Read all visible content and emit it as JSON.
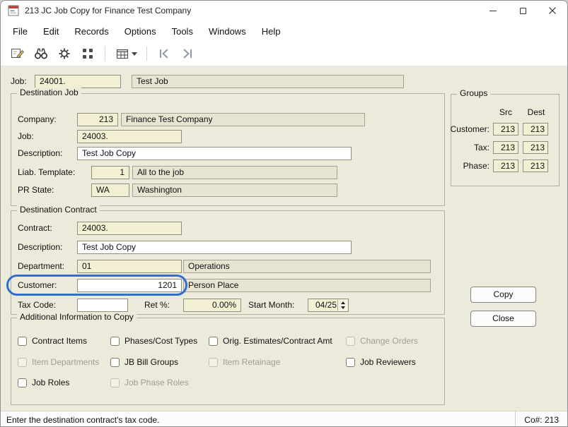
{
  "window": {
    "title": "213 JC Job Copy for Finance Test Company"
  },
  "menubar": {
    "items": [
      "File",
      "Edit",
      "Records",
      "Options",
      "Tools",
      "Windows",
      "Help"
    ]
  },
  "toolbar": {
    "icons": [
      "edit-record-icon",
      "find-binoculars-icon",
      "gear-icon",
      "grid-icon",
      "grid-dropdown-icon",
      "first-record-icon",
      "last-record-icon"
    ]
  },
  "colors": {
    "form_bg": "#eceadb",
    "field_cream": "#f2efd3",
    "field_disabled": "#e7e4d2",
    "focus_ring": "#2e6fd0"
  },
  "form": {
    "job_row": {
      "label": "Job:",
      "code": "24001.",
      "desc": "Test Job"
    },
    "dest_job": {
      "title": "Destination Job",
      "company_label": "Company:",
      "company_code": "213",
      "company_desc": "Finance Test Company",
      "job_label": "Job:",
      "job_code": "24003.",
      "desc_label": "Description:",
      "desc_value": "Test Job Copy",
      "liab_label": "Liab. Template:",
      "liab_code": "1",
      "liab_desc": "All to the job",
      "state_label": "PR State:",
      "state_code": "WA",
      "state_desc": "Washington"
    },
    "groups": {
      "title": "Groups",
      "src_header": "Src",
      "dest_header": "Dest",
      "rows": [
        {
          "label": "Customer:",
          "src": "213",
          "dest": "213"
        },
        {
          "label": "Tax:",
          "src": "213",
          "dest": "213"
        },
        {
          "label": "Phase:",
          "src": "213",
          "dest": "213"
        }
      ]
    },
    "dest_contract": {
      "title": "Destination Contract",
      "contract_label": "Contract:",
      "contract_code": "24003.",
      "desc_label": "Description:",
      "desc_value": "Test Job Copy",
      "dept_label": "Department:",
      "dept_code": "01",
      "dept_desc": "Operations",
      "customer_label": "Customer:",
      "customer_code": "1201",
      "customer_desc": "Person Place",
      "tax_label": "Tax Code:",
      "tax_value": "",
      "ret_label": "Ret %:",
      "ret_value": "0.00%",
      "month_label": "Start Month:",
      "month_value": "04/25"
    },
    "buttons": {
      "copy": "Copy",
      "close": "Close"
    },
    "additional": {
      "title": "Additional Information to Copy",
      "checkboxes": [
        {
          "label": "Contract Items",
          "checked": false,
          "enabled": true
        },
        {
          "label": "Phases/Cost Types",
          "checked": false,
          "enabled": true
        },
        {
          "label": "Orig. Estimates/Contract Amt",
          "checked": false,
          "enabled": true
        },
        {
          "label": "Change Orders",
          "checked": false,
          "enabled": false
        },
        {
          "label": "Item Departments",
          "checked": false,
          "enabled": false
        },
        {
          "label": "JB Bill Groups",
          "checked": false,
          "enabled": true
        },
        {
          "label": "Item Retainage",
          "checked": false,
          "enabled": false
        },
        {
          "label": "Job Reviewers",
          "checked": false,
          "enabled": true
        },
        {
          "label": "Job Roles",
          "checked": false,
          "enabled": true
        },
        {
          "label": "Job Phase Roles",
          "checked": false,
          "enabled": false
        }
      ]
    }
  },
  "statusbar": {
    "message": "Enter the destination contract's tax code.",
    "company": "Co#: 213"
  }
}
